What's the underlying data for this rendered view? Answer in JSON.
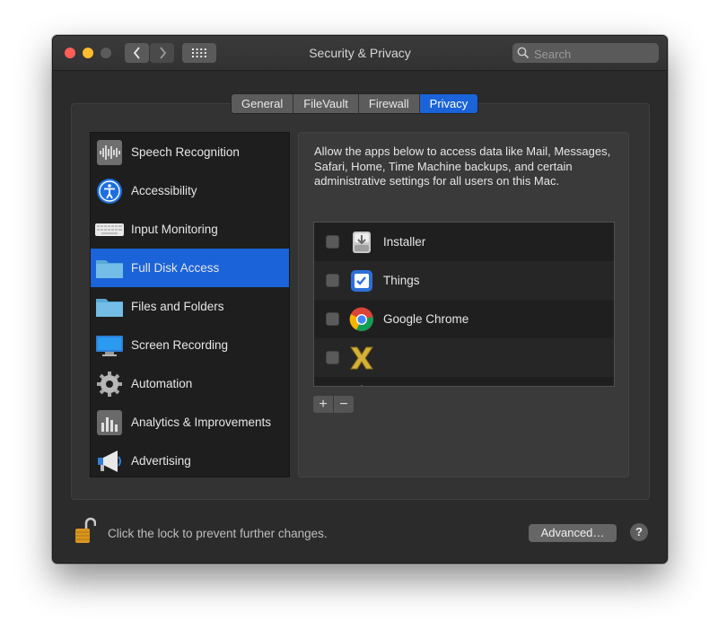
{
  "window": {
    "title": "Security & Privacy"
  },
  "search": {
    "placeholder": "Search"
  },
  "tabs": [
    {
      "label": "General",
      "active": false
    },
    {
      "label": "FileVault",
      "active": false
    },
    {
      "label": "Firewall",
      "active": false
    },
    {
      "label": "Privacy",
      "active": true
    }
  ],
  "sidebar": {
    "items": [
      {
        "label": "Speech Recognition",
        "icon": "waveform-icon",
        "selected": false
      },
      {
        "label": "Accessibility",
        "icon": "accessibility-icon",
        "selected": false
      },
      {
        "label": "Input Monitoring",
        "icon": "keyboard-icon",
        "selected": false
      },
      {
        "label": "Full Disk Access",
        "icon": "folder-icon",
        "selected": true
      },
      {
        "label": "Files and Folders",
        "icon": "folder-icon",
        "selected": false
      },
      {
        "label": "Screen Recording",
        "icon": "display-icon",
        "selected": false
      },
      {
        "label": "Automation",
        "icon": "gear-icon",
        "selected": false
      },
      {
        "label": "Analytics & Improvements",
        "icon": "bar-chart-icon",
        "selected": false
      },
      {
        "label": "Advertising",
        "icon": "megaphone-icon",
        "selected": false
      }
    ]
  },
  "main": {
    "description": "Allow the apps below to access data like Mail, Messages, Safari, Home, Time Machine backups, and certain administrative settings for all users on this Mac.",
    "apps": [
      {
        "label": "Installer",
        "icon": "installer-icon",
        "checked": false
      },
      {
        "label": "Things",
        "icon": "things-icon",
        "checked": false
      },
      {
        "label": "Google Chrome",
        "icon": "chrome-icon",
        "checked": false
      },
      {
        "label": "",
        "icon": "x-app-icon",
        "checked": false
      }
    ],
    "add_label": "+",
    "remove_label": "−"
  },
  "footer": {
    "lock_text": "Click the lock to prevent further changes.",
    "advanced_label": "Advanced…",
    "help_label": "?"
  },
  "colors": {
    "accent": "#1a63d8",
    "window_bg": "#2b2b2b",
    "sidebar_bg": "#1e1e1e"
  }
}
